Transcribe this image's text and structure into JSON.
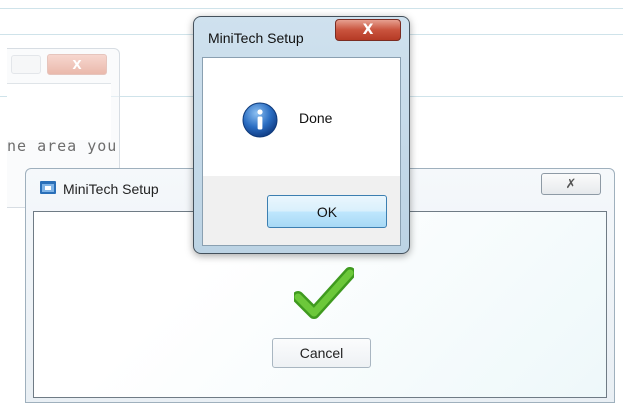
{
  "background_window": {
    "close_glyph": "X",
    "partial_text": "ne area you"
  },
  "main_window": {
    "title": "MiniTech Setup",
    "close_glyph": "✗",
    "cancel_label": "Cancel",
    "checkmark_color": "#5cb82e"
  },
  "dialog": {
    "title": "MiniTech Setup",
    "close_glyph": "X",
    "message": "Done",
    "ok_label": "OK",
    "icon": "info-icon",
    "icon_color": "#1c5fb8"
  }
}
